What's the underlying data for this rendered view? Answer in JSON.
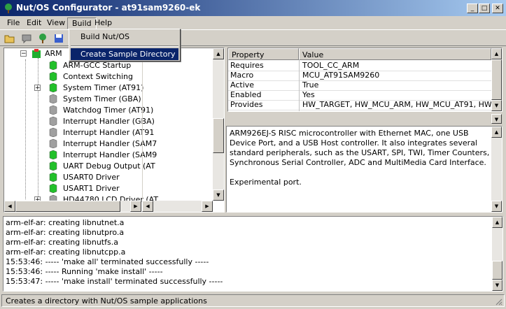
{
  "window": {
    "title": "Nut/OS Configurator - at91sam9260-ek",
    "buttons": {
      "minimize": "_",
      "maximize": "□",
      "close": "✕"
    }
  },
  "menu": {
    "items": [
      "File",
      "Edit",
      "View",
      "Build",
      "Help"
    ],
    "build_dropdown": [
      "Build Nut/OS",
      "Create Sample Directory"
    ]
  },
  "toolbar": {
    "icons": [
      "open-folder-icon",
      "speech-bubble-icon",
      "tree-icon",
      "save-disk-icon"
    ]
  },
  "tree": {
    "root_label": "ARM",
    "items": [
      {
        "label": "ARM-GCC Startup",
        "state": "enabled",
        "expandable": false
      },
      {
        "label": "Context Switching",
        "state": "enabled",
        "expandable": false
      },
      {
        "label": "System Timer (AT91)",
        "state": "enabled",
        "expandable": true
      },
      {
        "label": "System Timer (GBA)",
        "state": "disabled",
        "expandable": false
      },
      {
        "label": "Watchdog Timer (AT91)",
        "state": "disabled",
        "expandable": false
      },
      {
        "label": "Interrupt Handler (GBA)",
        "state": "disabled",
        "expandable": false
      },
      {
        "label": "Interrupt Handler (AT91",
        "state": "disabled",
        "expandable": false
      },
      {
        "label": "Interrupt Handler (SAM7",
        "state": "disabled",
        "expandable": false
      },
      {
        "label": "Interrupt Handler (SAM9",
        "state": "enabled",
        "expandable": false
      },
      {
        "label": "UART Debug Output (AT",
        "state": "enabled",
        "expandable": false
      },
      {
        "label": "USART0 Driver",
        "state": "enabled",
        "expandable": false
      },
      {
        "label": "USART1 Driver",
        "state": "enabled",
        "expandable": false
      },
      {
        "label": "HD44780 LCD Driver (AT",
        "state": "disabled",
        "expandable": true
      }
    ]
  },
  "properties": {
    "header_property": "Property",
    "header_value": "Value",
    "rows": [
      {
        "name": "Requires",
        "value": "TOOL_CC_ARM"
      },
      {
        "name": "Macro",
        "value": "MCU_AT91SAM9260"
      },
      {
        "name": "Active",
        "value": "True"
      },
      {
        "name": "Enabled",
        "value": "Yes"
      },
      {
        "name": "Provides",
        "value": "HW_TARGET, HW_MCU_ARM, HW_MCU_AT91, HW_MC"
      }
    ]
  },
  "description": {
    "paragraph1": "ARM926EJ-S RISC microcontroller with Ethernet MAC, one USB Device Port, and a USB Host controller. It also integrates several standard peripherals, such as the USART, SPI, TWI, Timer Counters, Synchronous Serial Controller, ADC and MultiMedia Card Interface.",
    "paragraph2": "Experimental port."
  },
  "log": {
    "lines": [
      "arm-elf-ar: creating libnutnet.a",
      "arm-elf-ar: creating libnutpro.a",
      "arm-elf-ar: creating libnutfs.a",
      "arm-elf-ar: creating libnutcpp.a",
      "15:53:46: ----- 'make all' terminated successfully -----",
      "15:53:46: ----- Running 'make install' -----",
      "15:53:47: ----- 'make install' terminated successfully -----"
    ]
  },
  "statusbar": {
    "text": "Creates a directory with Nut/OS sample applications"
  },
  "colors": {
    "titlebar_start": "#0a246a",
    "titlebar_end": "#a6caf0",
    "selection": "#0a246a",
    "module_enabled": "#22c02a",
    "module_disabled": "#a0a0a0"
  }
}
